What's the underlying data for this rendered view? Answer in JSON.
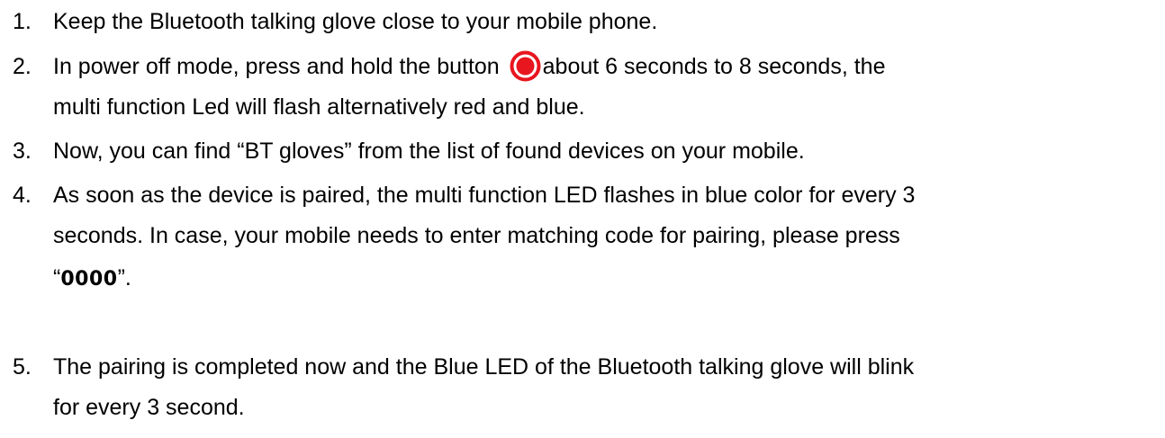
{
  "steps": [
    {
      "number": "1.",
      "line1": "Keep the Bluetooth talking glove close to your mobile phone."
    },
    {
      "number": "2.",
      "line1_before_icon": "In power off mode, press and hold the button ",
      "button_icon": "power-button-icon",
      "line1_after_icon": "about 6 seconds to 8 seconds, the",
      "line2": "multi function Led will flash alternatively red and blue."
    },
    {
      "number": "3.",
      "line1": "Now, you can find “BT gloves” from the list of found devices on your mobile."
    },
    {
      "number": "4.",
      "line1": "As soon as the device is paired, the multi function LED flashes in blue color for every 3",
      "line2": "seconds. In case, your mobile needs to enter matching code for pairing, please press",
      "line3_open_quote": " “",
      "line3_code": "0000",
      "line3_close": "”."
    },
    {
      "number": "5.",
      "line1": "The pairing is completed now and the Blue LED of the Bluetooth talking glove will blink",
      "line2": "for every 3 second."
    }
  ],
  "colors": {
    "text": "#000000",
    "button_icon": "#e8161f"
  }
}
